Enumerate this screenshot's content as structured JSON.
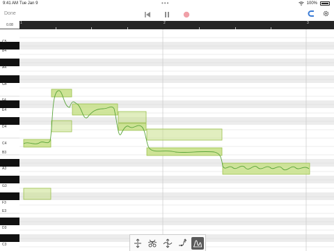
{
  "status_bar": {
    "time": "9:41 AM",
    "date": "Tue Jan 9",
    "battery": "100%"
  },
  "toolbar": {
    "done_label": "Done"
  },
  "ruler": {
    "value_readout": "0.08",
    "bar_numbers": [
      "1",
      "2",
      "3"
    ]
  },
  "keyboard": {
    "labels": [
      "C5",
      "B4",
      "A4",
      "G4",
      "F4",
      "E4",
      "D4",
      "C4",
      "B3",
      "A3",
      "G3",
      "F3",
      "E3",
      "D3",
      "C3"
    ]
  },
  "colors": {
    "note_fill": "#c8e08a",
    "note_stroke": "#9cc24e",
    "pitch_line": "#5aa43a",
    "record": "#f0a0a8",
    "accent_blue": "#3a7bd5"
  },
  "icons": {
    "transport": [
      "rewind-icon",
      "pause-icon",
      "record-icon"
    ],
    "right": [
      "magnet-icon",
      "gear-icon"
    ],
    "tools": [
      "pitch-tool-icon",
      "split-tool-icon",
      "move-tool-icon",
      "drift-tool-icon",
      "waveform-tool-icon"
    ]
  },
  "notes_summary": {
    "count": 11,
    "pitch_curve": "visible"
  }
}
